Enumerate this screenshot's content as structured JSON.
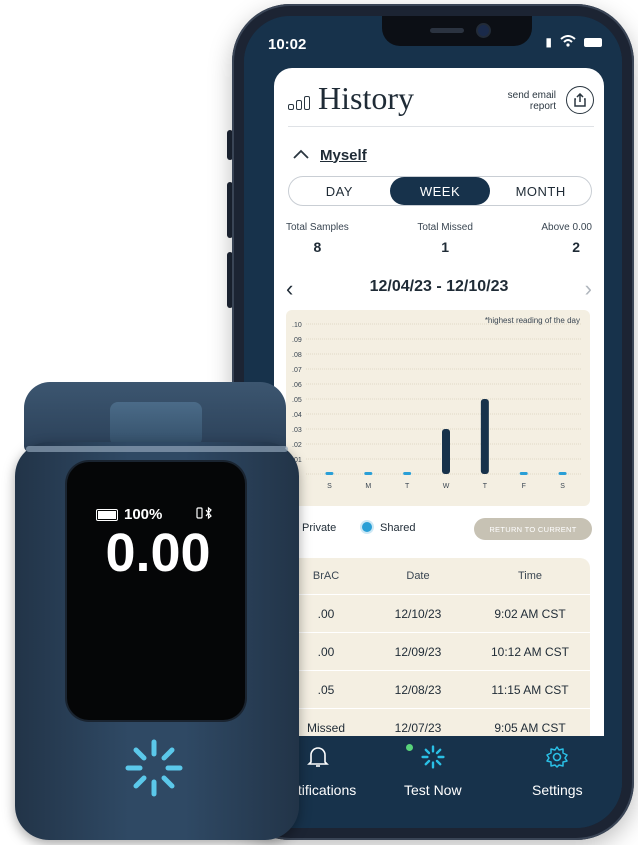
{
  "status_bar": {
    "time": "10:02"
  },
  "history": {
    "title": "History",
    "send_email": "send email report",
    "person": "Myself",
    "segments": [
      "DAY",
      "WEEK",
      "MONTH"
    ],
    "active_segment": "WEEK",
    "stats": [
      {
        "label": "Total Samples",
        "value": "8"
      },
      {
        "label": "Total Missed",
        "value": "1"
      },
      {
        "label": "Above 0.00",
        "value": "2"
      }
    ],
    "date_range": "12/04/23 - 12/10/23",
    "visibility": {
      "private": "Private",
      "shared": "Shared",
      "selected": "Shared"
    },
    "return_button": "RETURN TO CURRENT",
    "table": {
      "headers": [
        "BrAC",
        "Date",
        "Time"
      ],
      "rows": [
        {
          "brac": ".00",
          "date": "12/10/23",
          "time": "9:02 AM CST"
        },
        {
          "brac": ".00",
          "date": "12/09/23",
          "time": "10:12 AM CST"
        },
        {
          "brac": ".05",
          "date": "12/08/23",
          "time": "11:15 AM CST"
        },
        {
          "brac": "Missed",
          "date": "12/07/23",
          "time": "9:05 AM CST"
        }
      ]
    }
  },
  "chart_data": {
    "type": "bar",
    "categories": [
      "S",
      "M",
      "T",
      "W",
      "T",
      "F",
      "S"
    ],
    "values": [
      0.0,
      0.0,
      0.0,
      0.03,
      0.05,
      0.0,
      0.0
    ],
    "ylim": [
      0,
      0.1
    ],
    "yticks": [
      ".10",
      ".09",
      ".08",
      ".07",
      ".06",
      ".05",
      ".04",
      ".03",
      ".02",
      ".01",
      "0"
    ],
    "annotation": "*highest reading of the day",
    "bar_color": "#17324b",
    "zero_marker_color": "#2a9fd6",
    "grid": true
  },
  "tabbar": {
    "items": [
      {
        "label": "Notifications",
        "icon": "bell-icon"
      },
      {
        "label": "Test Now",
        "icon": "burst-logo-icon"
      },
      {
        "label": "Settings",
        "icon": "gear-icon"
      }
    ]
  },
  "device": {
    "battery": "100%",
    "reading": "0.00"
  },
  "colors": {
    "navy": "#17324b",
    "accent": "#2ac0e6",
    "chart_bg": "#f4efe2"
  }
}
